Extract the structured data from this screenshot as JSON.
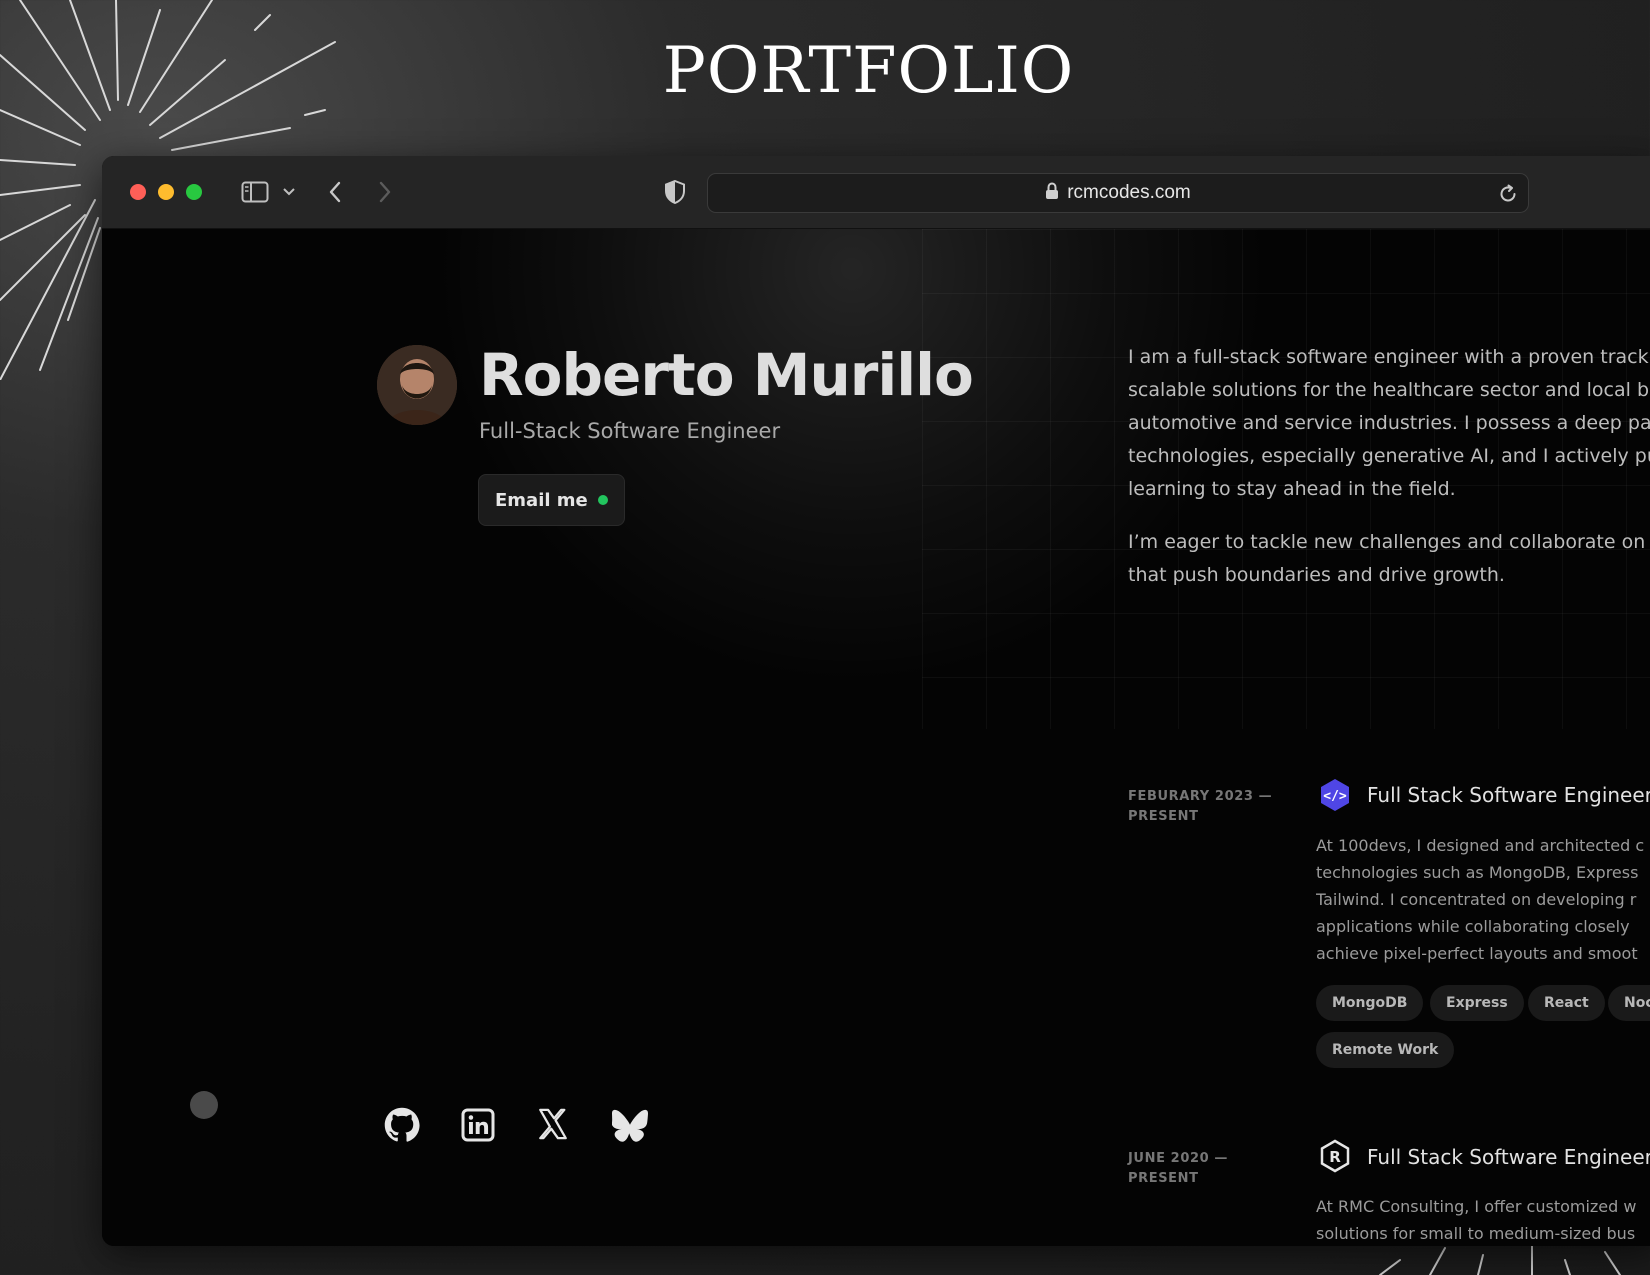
{
  "poster": {
    "title": "PORTFOLIO"
  },
  "browser": {
    "url": "rcmcodes.com",
    "icons": [
      "close-dot",
      "minimize-dot",
      "maximize-dot",
      "sidebar-icon",
      "chevron-down-icon",
      "back-arrow-icon",
      "forward-arrow-icon",
      "shield-icon",
      "lock-icon",
      "reload-icon"
    ]
  },
  "profile": {
    "name": "Roberto Murillo",
    "role": "Full-Stack Software Engineer",
    "email_label": "Email me",
    "status_color": "#22c55e"
  },
  "about": {
    "paragraphs": [
      [
        "I am a full-stack software engineer with a proven track",
        "scalable solutions for the healthcare sector and local bu",
        "automotive and service industries. I possess a deep pas",
        "technologies, especially generative AI, and I actively pu",
        "learning to stay ahead in the field."
      ],
      [
        "I’m eager to tackle new challenges and collaborate on i",
        "that push boundaries and drive growth."
      ]
    ]
  },
  "experience": [
    {
      "date_line1": "FEBURARY 2023 —",
      "date_line2": "PRESENT",
      "logo_icon": "code-icon",
      "title": "Full Stack Software Engineer",
      "desc": [
        "At 100devs, I designed and architected c",
        "technologies such as MongoDB, Express",
        "Tailwind. I concentrated on developing r",
        "applications while collaborating closely",
        "achieve pixel-perfect layouts and smoot"
      ],
      "tags": [
        "MongoDB",
        "Express",
        "React",
        "Noc",
        "Remote Work"
      ]
    },
    {
      "date_line1": "JUNE 2020 —",
      "date_line2": "PRESENT",
      "logo_icon": "r-hexagon-icon",
      "title": "Full Stack Software Engineer",
      "desc": [
        "At RMC Consulting, I offer customized w",
        "solutions for small to medium-sized bus"
      ]
    }
  ],
  "social": [
    "github-icon",
    "linkedin-icon",
    "x-icon",
    "bluesky-icon"
  ],
  "colors": {
    "accent": "#22c55e",
    "logo_blue": "#4f46e5",
    "background": "#040404"
  }
}
